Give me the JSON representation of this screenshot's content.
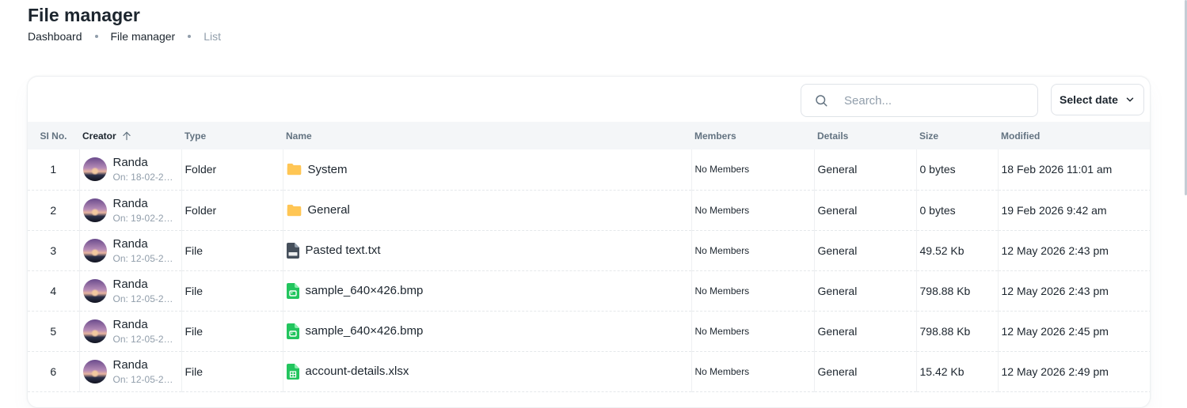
{
  "page": {
    "title": "File manager",
    "breadcrumbs": [
      "Dashboard",
      "File manager",
      "List"
    ]
  },
  "toolbar": {
    "search_placeholder": "Search...",
    "date_button": "Select date"
  },
  "table": {
    "columns": [
      "SI No.",
      "Creator",
      "Type",
      "Name",
      "Members",
      "Details",
      "Size",
      "Modified"
    ],
    "rows": [
      {
        "si": "1",
        "creator": "Randa",
        "created_on": "On: 18-02-20...",
        "type": "Folder",
        "icon": "folder-icon",
        "name": "System",
        "members": "No Members",
        "details": "General",
        "size": "0 bytes",
        "modified": "18 Feb 2026 11:01 am"
      },
      {
        "si": "2",
        "creator": "Randa",
        "created_on": "On: 19-02-20...",
        "type": "Folder",
        "icon": "folder-icon",
        "name": "General",
        "members": "No Members",
        "details": "General",
        "size": "0 bytes",
        "modified": "19 Feb 2026 9:42 am"
      },
      {
        "si": "3",
        "creator": "Randa",
        "created_on": "On: 12-05-20...",
        "type": "File",
        "icon": "txt-file-icon",
        "name": "Pasted text.txt",
        "members": "No Members",
        "details": "General",
        "size": "49.52 Kb",
        "modified": "12 May 2026 2:43 pm"
      },
      {
        "si": "4",
        "creator": "Randa",
        "created_on": "On: 12-05-20...",
        "type": "File",
        "icon": "image-file-icon",
        "name": "sample_640×426.bmp",
        "members": "No Members",
        "details": "General",
        "size": "798.88 Kb",
        "modified": "12 May 2026 2:43 pm"
      },
      {
        "si": "5",
        "creator": "Randa",
        "created_on": "On: 12-05-20...",
        "type": "File",
        "icon": "image-file-icon",
        "name": "sample_640×426.bmp",
        "members": "No Members",
        "details": "General",
        "size": "798.88 Kb",
        "modified": "12 May 2026 2:45 pm"
      },
      {
        "si": "6",
        "creator": "Randa",
        "created_on": "On: 12-05-20...",
        "type": "File",
        "icon": "spreadsheet-file-icon",
        "name": "account-details.xlsx",
        "members": "No Members",
        "details": "General",
        "size": "15.42 Kb",
        "modified": "12 May 2026 2:49 pm"
      }
    ]
  },
  "colors": {
    "folder": "#ffc555",
    "txt_file": "#454f5b",
    "green_file": "#22c55e"
  }
}
